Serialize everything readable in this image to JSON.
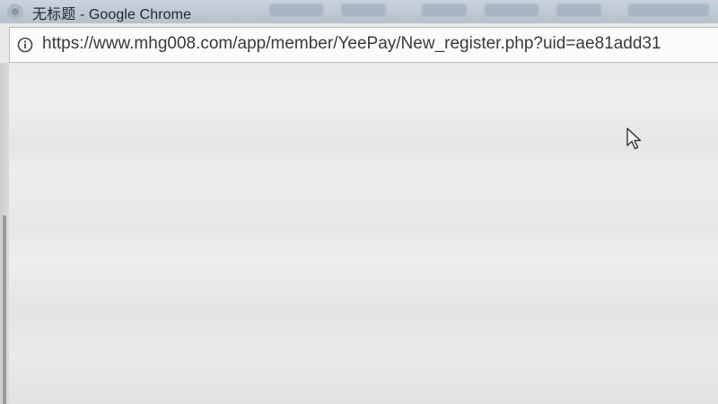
{
  "window": {
    "title": "无标题 - Google Chrome"
  },
  "addressbar": {
    "url": "https://www.mhg008.com/app/member/YeePay/New_register.php?uid=ae81add31"
  },
  "icons": {
    "page_info": "info-icon",
    "browser": "chrome-icon",
    "pointer": "mouse-cursor-icon"
  },
  "colors": {
    "titlebar": "#b6c1cc",
    "page_background": "#edebea"
  }
}
